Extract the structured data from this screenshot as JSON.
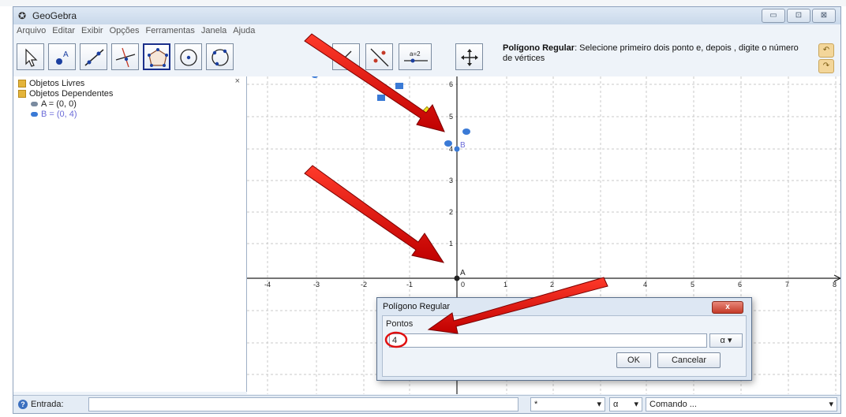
{
  "window": {
    "title": "GeoGebra",
    "controls": [
      "▭",
      "⊡",
      "⊠"
    ]
  },
  "menu": [
    "Arquivo",
    "Editar",
    "Exibir",
    "Opções",
    "Ferramentas",
    "Janela",
    "Ajuda"
  ],
  "toolbar": {
    "help_title": "Polígono Regular",
    "help_text": ": Selecione primeiro dois ponto e, depois , digite o número de vértices",
    "tools": [
      "move-tool",
      "point-tool",
      "line-tool",
      "perpendicular-line-tool",
      "polygon-tool",
      "circle-tool",
      "circle-three-points-tool",
      "angle-tool",
      "reflect-tool",
      "slider-tool",
      "move-graphics-tool"
    ],
    "slider_label": "a=2",
    "selected_tool": "polygon-tool"
  },
  "algebra": {
    "free_objects_label": "Objetos Livres",
    "dependent_objects_label": "Objetos Dependentes",
    "items": [
      {
        "text": "A = (0, 0)",
        "color": "#222222"
      },
      {
        "text": "B = (0, 4)",
        "color": "#6b6bd8"
      }
    ],
    "close_glyph": "×"
  },
  "graphics": {
    "x_ticks": [
      "-4",
      "-3",
      "-2",
      "-1",
      "0",
      "1",
      "2",
      "3",
      "4",
      "5",
      "6",
      "7",
      "8"
    ],
    "y_ticks": [
      "1",
      "2",
      "3",
      "4",
      "5",
      "6"
    ],
    "point_labels": [
      "A",
      "B"
    ]
  },
  "dialog": {
    "title": "Polígono Regular",
    "close_glyph": "x",
    "field_label": "Pontos",
    "value": "4",
    "alpha_label": "α ▾",
    "ok_label": "OK",
    "cancel_label": "Cancelar"
  },
  "input_bar": {
    "label": "Entrada:",
    "combo1": "*",
    "combo2": "α",
    "combo3": "Comando ..."
  },
  "colors": {
    "arrow": "#e01010",
    "highlight_circle": "#e01010",
    "point_blue": "#3a7ad6",
    "grid": "#c8c8c8"
  }
}
